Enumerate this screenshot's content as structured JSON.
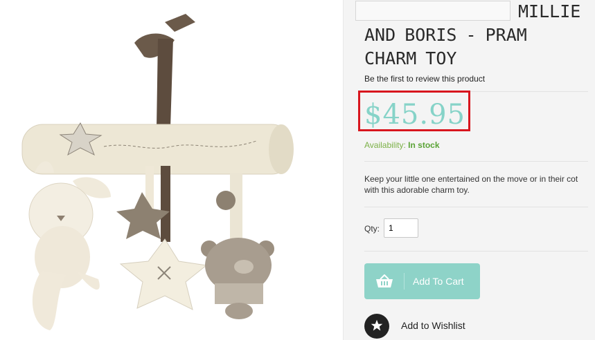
{
  "product": {
    "name": "MILLIE AND BORIS - PRAM CHARM TOY",
    "review_link": "Be the first to review this product",
    "price": "$45.95",
    "availability_label": "Availability:",
    "availability_value": "In stock",
    "description": "Keep your little one entertained on the move or in their cot with this adorable charm toy.",
    "qty_label": "Qty:",
    "qty_value": "1",
    "add_to_cart_label": "Add To Cart",
    "wishlist_label": "Add to Wishlist"
  },
  "icons": {
    "cart": "basket-icon",
    "wishlist": "star-icon"
  },
  "colors": {
    "price": "#86d3c8",
    "button": "#8ed3c8",
    "availability": "#5aa336",
    "highlight": "#d8161e"
  }
}
